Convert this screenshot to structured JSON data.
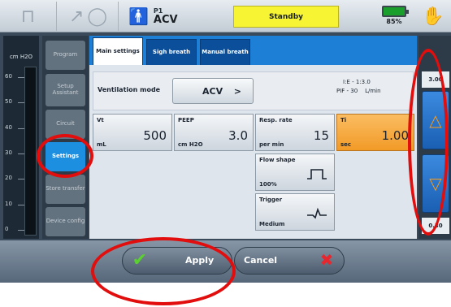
{
  "header": {
    "mode_small": "P1",
    "mode_big": "ACV",
    "status": "Standby",
    "battery_pct": "85%",
    "icons": [
      "lock-icon",
      "arrow-icon",
      "lungs-icon",
      "patient-icon",
      "battery-icon",
      "hand-icon"
    ]
  },
  "pressure": {
    "unit": "cm H2O",
    "ticks": [
      "60",
      "50",
      "40",
      "30",
      "20",
      "10",
      "0"
    ]
  },
  "menu": {
    "items": [
      {
        "label": "Program"
      },
      {
        "label": "Setup Assistant"
      },
      {
        "label": "Circuit"
      },
      {
        "label": "Settings"
      },
      {
        "label": "Store transfer"
      },
      {
        "label": "Device config"
      }
    ],
    "active": "Settings"
  },
  "tabs": [
    {
      "label": "Main settings"
    },
    {
      "label": "Sigh breath"
    },
    {
      "label": "Manual breath"
    }
  ],
  "ventilation": {
    "label": "Ventilation mode",
    "value": "ACV",
    "chevron": ">",
    "ie_line": "I:E - 1:3.0",
    "pif_line": "PIF - 30    L/min"
  },
  "params": {
    "vt": {
      "label": "Vt",
      "value": "500",
      "unit": "mL"
    },
    "peep": {
      "label": "PEEP",
      "value": "3.0",
      "unit": "cm H2O"
    },
    "rate": {
      "label": "Resp. rate",
      "value": "15",
      "unit": "per min"
    },
    "ti": {
      "label": "Ti",
      "value": "1.00",
      "unit": "sec"
    },
    "flow": {
      "label": "Flow shape",
      "value": "100%"
    },
    "trigger": {
      "label": "Trigger",
      "value": "Medium"
    }
  },
  "rail": {
    "max": "3.00",
    "min": "0.30"
  },
  "footer": {
    "apply": "Apply",
    "cancel": "Cancel"
  },
  "colors": {
    "accent": "#1e7fd6",
    "active_param": "#f19a27",
    "status_bg": "#f7f533",
    "annotation": "#e20d0d"
  }
}
